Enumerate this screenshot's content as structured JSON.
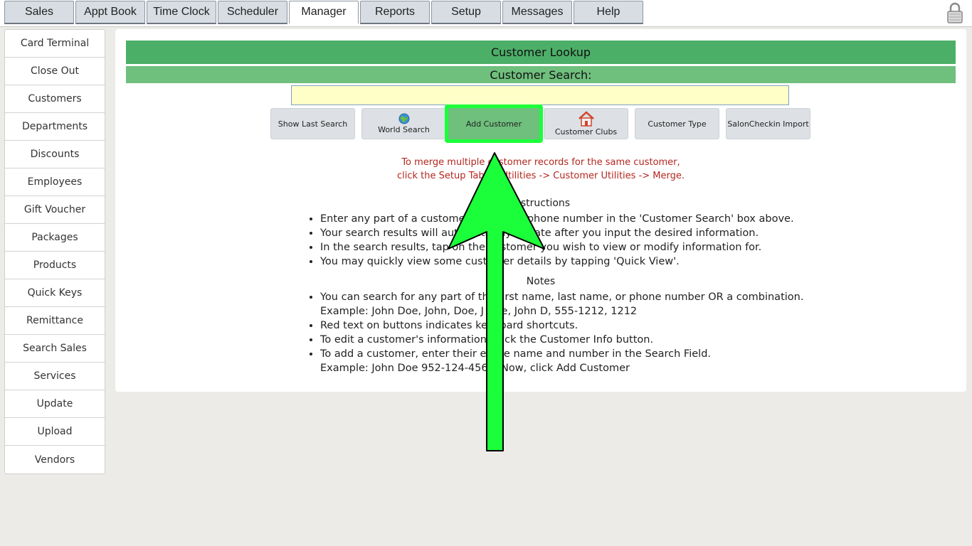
{
  "tabs": [
    "Sales",
    "Appt Book",
    "Time Clock",
    "Scheduler",
    "Manager",
    "Reports",
    "Setup",
    "Messages",
    "Help"
  ],
  "active_tab": "Manager",
  "sidebar": {
    "items": [
      "Card Terminal",
      "Close Out",
      "Customers",
      "Departments",
      "Discounts",
      "Employees",
      "Gift Voucher",
      "Packages",
      "Products",
      "Quick Keys",
      "Remittance",
      "Search Sales",
      "Services",
      "Update",
      "Upload",
      "Vendors"
    ]
  },
  "main": {
    "title": "Customer Lookup",
    "search_label": "Customer Search:",
    "search_value": "",
    "buttons": {
      "show_last": "Show Last Search",
      "world_search": "World Search",
      "add_customer": "Add Customer",
      "customer_clubs": "Customer Clubs",
      "customer_type": "Customer Type",
      "salon_import": "SalonCheckin Import"
    },
    "merge_line1": "To merge multiple customer records for the same customer,",
    "merge_line2": "click the Setup Tab -> Utilities -> Customer Utilities -> Merge.",
    "instructions_title": "Instructions",
    "instructions": [
      "Enter any part of a customer's name or phone number in the 'Customer Search' box above.",
      "Your search results will automatically update after you input the desired information.",
      "In the search results, tap on the customer you wish to view or modify information for.",
      "You may quickly view some customer details by tapping 'Quick View'."
    ],
    "notes_title": "Notes",
    "notes": [
      {
        "text": "You can search for any part of the first name, last name, or phone number OR a combination.",
        "sub": "Example: John Doe, John, Doe, J Doe, John D, 555-1212, 1212"
      },
      {
        "text": "Red text on buttons indicates keyboard shortcuts.",
        "sub": ""
      },
      {
        "text": "To edit a customer's information, click the Customer Info button.",
        "sub": ""
      },
      {
        "text": "To add a customer, enter their entire name and number in the Search Field.",
        "sub": "Example: John Doe 952-124-4567. Now, click Add Customer"
      }
    ]
  },
  "colors": {
    "header_green": "#4caf68",
    "subheader_green": "#6fbf7d",
    "highlight": "#1bff3a",
    "merge_text": "#b3261e"
  }
}
